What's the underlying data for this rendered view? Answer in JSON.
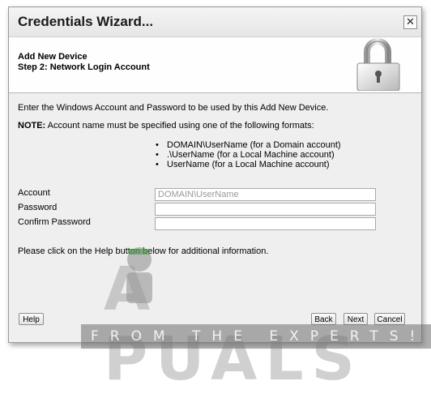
{
  "dialog": {
    "title": "Credentials Wizard...",
    "close_label": "✕"
  },
  "header": {
    "line1": "Add New Device",
    "line2": "Step 2: Network Login Account",
    "icon": "padlock-icon"
  },
  "body": {
    "intro": "Enter the Windows Account and Password to be used by this Add New Device.",
    "note_label": "NOTE:",
    "note_text": " Account name must be specified using one of the following formats:",
    "formats": [
      "DOMAIN\\UserName (for a Domain account)",
      ".\\UserName (for a Local Machine account)",
      "UserName (for a Local Machine account)"
    ],
    "bullet": "•",
    "help_text": "Please click on the Help button below for additional information."
  },
  "form": {
    "account_label": "Account",
    "account_placeholder": "DOMAIN\\UserName",
    "account_value": "",
    "password_label": "Password",
    "password_value": "",
    "confirm_label": "Confirm Password",
    "confirm_value": ""
  },
  "buttons": {
    "help": "Help",
    "back": "Back",
    "next": "Next",
    "cancel": "Cancel"
  },
  "watermark": {
    "brand": "A PUALS",
    "tagline": "FROM THE EXPERTS!"
  },
  "colors": {
    "dialog_bg": "#efefef",
    "header_bg": "#fefefe",
    "accent_watermark": "#969696"
  }
}
